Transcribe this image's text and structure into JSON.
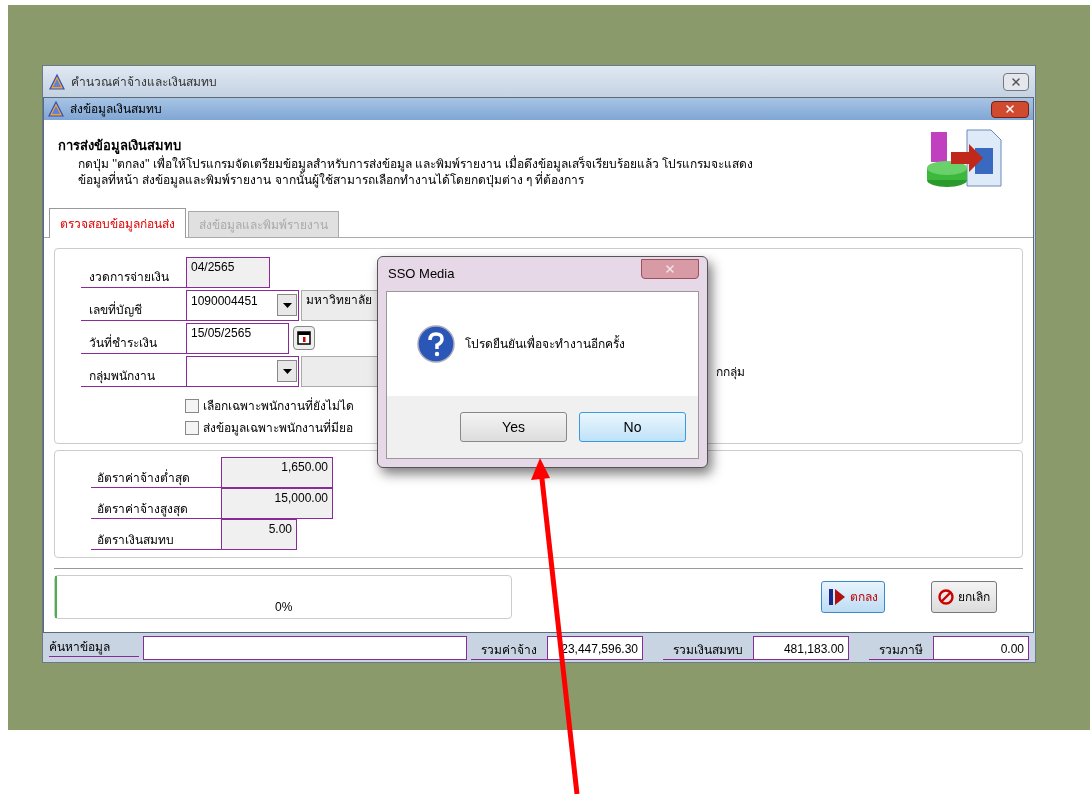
{
  "outer_window": {
    "title": "คำนวณค่าจ้างและเงินสมทบ",
    "bottom_bar": {
      "search_label": "ค้นหาข้อมูล",
      "totals": [
        {
          "label": "รวมค่าจ้าง",
          "value": "23,447,596.30"
        },
        {
          "label": "รวมเงินสมทบ",
          "value": "481,183.00"
        },
        {
          "label": "รวมภาษี",
          "value": "0.00"
        }
      ]
    }
  },
  "window": {
    "title": "ส่งข้อมูลเงินสมทบ",
    "header": {
      "heading": "การส่งข้อมูลเงินสมทบ",
      "description": [
        "กดปุ่ม ''ตกลง'' เพื่อให้โปรแกรมจัดเตรียมข้อมูลสำหรับการส่งข้อมูล และพิมพ์รายงาน เมื่อดึงข้อมูลเสร็จเรียบร้อยแล้ว โปรแกรมจะแสดง",
        "ข้อมูลที่หน้า ส่งข้อมูลและพิมพ์รายงาน จากนั้นผู้ใช้สามารถเลือกทำงานได้โดยกดปุ่มต่าง ๆ ที่ต้องการ"
      ]
    },
    "tabs": [
      {
        "label": "ตรวจสอบข้อมูลก่อนส่ง",
        "selected": true
      },
      {
        "label": "ส่งข้อมูลและพิมพ์รายงาน",
        "selected": false
      }
    ],
    "fields": [
      {
        "kind": "text",
        "label": "งวดการจ่ายเงิน",
        "value": "04/2565"
      },
      {
        "kind": "dropdown",
        "label": "เลขที่บัญชี",
        "value": "1090004451",
        "extra": "มหาวิทยาลัย"
      },
      {
        "kind": "date",
        "label": "วันที่ชำระเงิน",
        "value": "15/05/2565"
      },
      {
        "kind": "dropdown",
        "label": "กลุ่มพนักงาน",
        "side_text": "กกลุ่ม"
      }
    ],
    "checkboxes": [
      {
        "label": "เลือกเฉพาะพนักงานที่ยังไม่ได",
        "checked": false
      },
      {
        "label": "ส่งข้อมูลเฉพาะพนักงานที่มียอ",
        "checked": false
      }
    ],
    "rates": [
      {
        "label": "อัตราค่าจ้างต่ำสุด",
        "value": "1,650.00"
      },
      {
        "label": "อัตราค่าจ้างสูงสุด",
        "value": "15,000.00"
      },
      {
        "label": "อัตราเงินสมทบ",
        "value": "5.00"
      }
    ],
    "progress": {
      "level": 0,
      "reading": "0%"
    },
    "buttons": [
      {
        "kind": "ok",
        "label": "ตกลง",
        "selected": true
      },
      {
        "kind": "cancel",
        "label": "ยกเลิก",
        "selected": false
      }
    ]
  },
  "dialog": {
    "title": "SSO Media",
    "message": "โปรดยืนยันเพื่อจะทำงานอีกครั้ง",
    "buttons": [
      {
        "label": "Yes",
        "selected": false
      },
      {
        "label": "No",
        "selected": true
      }
    ]
  }
}
